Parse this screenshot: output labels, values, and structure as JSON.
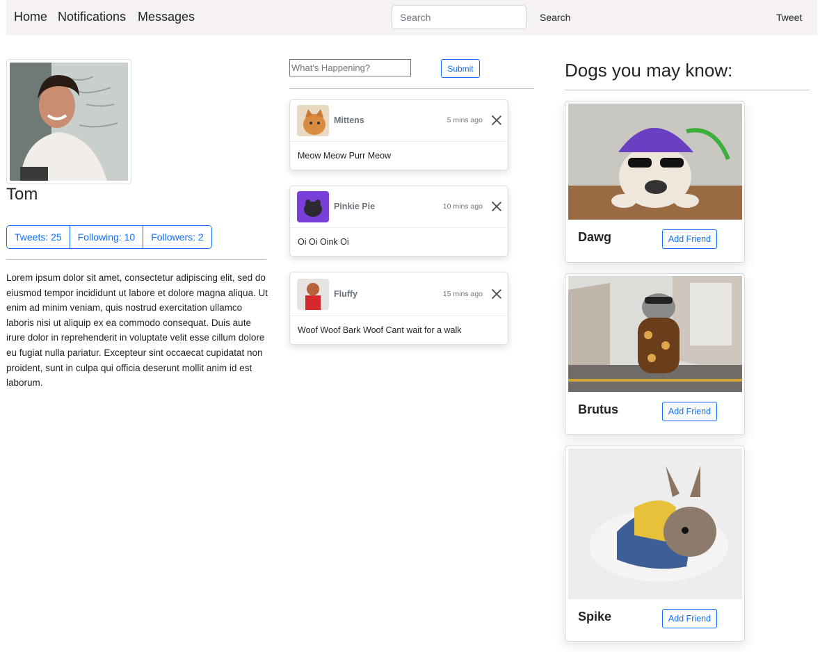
{
  "nav": {
    "links": [
      "Home",
      "Notifications",
      "Messages"
    ],
    "search_placeholder": "Search",
    "search_button": "Search",
    "tweet_button": "Tweet"
  },
  "profile": {
    "name": "Tom",
    "stats": {
      "tweets": "Tweets: 25",
      "following": "Following: 10",
      "followers": "Followers: 2"
    },
    "bio": "Lorem ipsum dolor sit amet, consectetur adipiscing elit, sed do eiusmod tempor incididunt ut labore et dolore magna aliqua. Ut enim ad minim veniam, quis nostrud exercitation ullamco laboris nisi ut aliquip ex ea commodo consequat. Duis aute irure dolor in reprehenderit in voluptate velit esse cillum dolore eu fugiat nulla pariatur. Excepteur sint occaecat cupidatat non proident, sunt in culpa qui officia deserunt mollit anim id est laborum."
  },
  "composer": {
    "placeholder": "What's Happening?",
    "submit_label": "Submit"
  },
  "feed": [
    {
      "name": "Mittens",
      "time": "5 mins ago",
      "text": "Meow Meow Purr Meow"
    },
    {
      "name": "Pinkie Pie",
      "time": "10 mins ago",
      "text": "Oi Oi Oink Oi"
    },
    {
      "name": "Fluffy",
      "time": "15 mins ago",
      "text": "Woof Woof Bark Woof Cant wait for a walk"
    }
  ],
  "suggestions": {
    "title": "Dogs you may know:",
    "add_label": "Add Friend",
    "items": [
      {
        "name": "Dawg"
      },
      {
        "name": "Brutus"
      },
      {
        "name": "Spike"
      }
    ]
  },
  "colors": {
    "primary": "#0d6efd",
    "navbar_bg": "#f5f2f1",
    "muted": "#6c757d"
  }
}
